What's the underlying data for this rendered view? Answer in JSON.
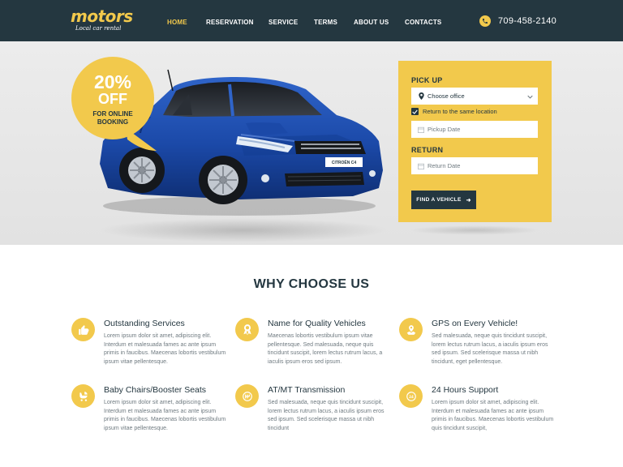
{
  "header": {
    "logo": "motors",
    "tagline": "Local car rental",
    "nav": [
      "HOME",
      "RESERVATION",
      "SERVICE",
      "TERMS",
      "ABOUT US",
      "CONTACTS"
    ],
    "phone": "709-458-2140",
    "colors": {
      "header_bg": "#243740",
      "accent": "#f2c94c"
    }
  },
  "hero": {
    "promo": {
      "percent": "20%",
      "off": "OFF",
      "line1": "FOR ONLINE",
      "line2": "BOOKING"
    },
    "car_plate": "CITROËN C4"
  },
  "booking": {
    "pickup_label": "PICK UP",
    "office_value": "Choose office",
    "same_location_label": "Return to the same location",
    "same_location_checked": true,
    "pickup_date_placeholder": "Pickup Date",
    "return_label": "RETURN",
    "return_date_placeholder": "Return Date",
    "find_button": "FIND A VEHICLE"
  },
  "why": {
    "title": "WHY CHOOSE US",
    "features": [
      {
        "icon": "thumbs-up-icon",
        "title": "Outstanding Services",
        "text": "Lorem ipsum dolor sit amet, adipiscing elit. Interdum et malesuada fames ac ante ipsum primis in faucibus. Maecenas lobortis vestibulum ipsum vitae pellentesque."
      },
      {
        "icon": "award-icon",
        "title": "Name for Quality Vehicles",
        "text": "Maecenas lobortis vestibulum ipsum vitae pellentesque. Sed malesuada, neque quis tincidunt suscipit, lorem lectus rutrum lacus, a iaculis ipsum eros sed ipsum."
      },
      {
        "icon": "map-pin-icon",
        "title": "GPS on Every Vehicle!",
        "text": "Sed malesuada, neque quis tincidunt suscipit, lorem lectus rutrum lacus, a iaculis ipsum eros sed ipsum. Sed scelerisque massa ut nibh tincidunt, eget pellentesque."
      },
      {
        "icon": "baby-stroller-icon",
        "title": "Baby Chairs/Booster Seats",
        "text": "Lorem ipsum dolor sit amet, adipiscing elit. Interdum et malesuada fames ac ante ipsum primis in faucibus. Maecenas lobortis vestibulum ipsum vitae pellentesque."
      },
      {
        "icon": "transmission-icon",
        "title": "AT/MT Transmission",
        "text": "Sed malesuada, neque quis tincidunt suscipit, lorem lectus rutrum lacus, a iaculis ipsum eros sed ipsum. Sed scelerisque massa ut nibh tincidunt"
      },
      {
        "icon": "clock-24-icon",
        "title": "24 Hours Support",
        "text": "Lorem ipsum dolor sit amet, adipiscing elit. Interdum et malesuada fames ac ante ipsum primis in faucibus. Maecenas lobortis vestibulum quis tincidunt suscipit,"
      }
    ]
  }
}
